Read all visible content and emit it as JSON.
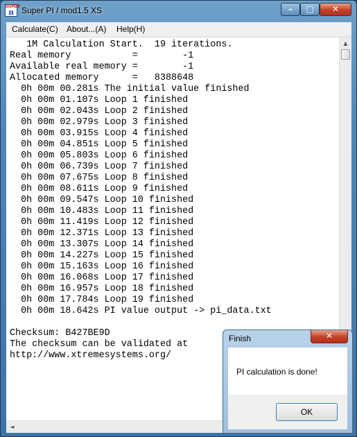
{
  "window": {
    "title": "Super PI / mod1.5 XS",
    "icon_text_top": "SUPER",
    "icon_text_pi": "π",
    "controls": {
      "minimize": "–",
      "maximize": "□",
      "close": "✕"
    }
  },
  "menu": {
    "items": [
      {
        "label": "Calculate(C)"
      },
      {
        "label": "About...(A)"
      },
      {
        "label": "Help(H)"
      }
    ]
  },
  "console": {
    "lines": [
      "   1M Calculation Start.  19 iterations.",
      "Real memory           =        -1",
      "Available real memory =        -1",
      "Allocated memory      =   8388648",
      "  0h 00m 00.281s The initial value finished",
      "  0h 00m 01.107s Loop 1 finished",
      "  0h 00m 02.043s Loop 2 finished",
      "  0h 00m 02.979s Loop 3 finished",
      "  0h 00m 03.915s Loop 4 finished",
      "  0h 00m 04.851s Loop 5 finished",
      "  0h 00m 05.803s Loop 6 finished",
      "  0h 00m 06.739s Loop 7 finished",
      "  0h 00m 07.675s Loop 8 finished",
      "  0h 00m 08.611s Loop 9 finished",
      "  0h 00m 09.547s Loop 10 finished",
      "  0h 00m 10.483s Loop 11 finished",
      "  0h 00m 11.419s Loop 12 finished",
      "  0h 00m 12.371s Loop 13 finished",
      "  0h 00m 13.307s Loop 14 finished",
      "  0h 00m 14.227s Loop 15 finished",
      "  0h 00m 15.163s Loop 16 finished",
      "  0h 00m 16.068s Loop 17 finished",
      "  0h 00m 16.957s Loop 18 finished",
      "  0h 00m 17.784s Loop 19 finished",
      "  0h 00m 18.642s PI value output -> pi_data.txt",
      "",
      "Checksum: B427BE9D",
      "The checksum can be validated at",
      "http://www.xtremesystems.org/"
    ]
  },
  "scrollbars": {
    "up": "▲",
    "down": "▼",
    "left": "◄",
    "right": "►"
  },
  "dialog": {
    "title": "Finish",
    "close": "✕",
    "message": "PI calculation is done!",
    "ok_label": "OK"
  }
}
